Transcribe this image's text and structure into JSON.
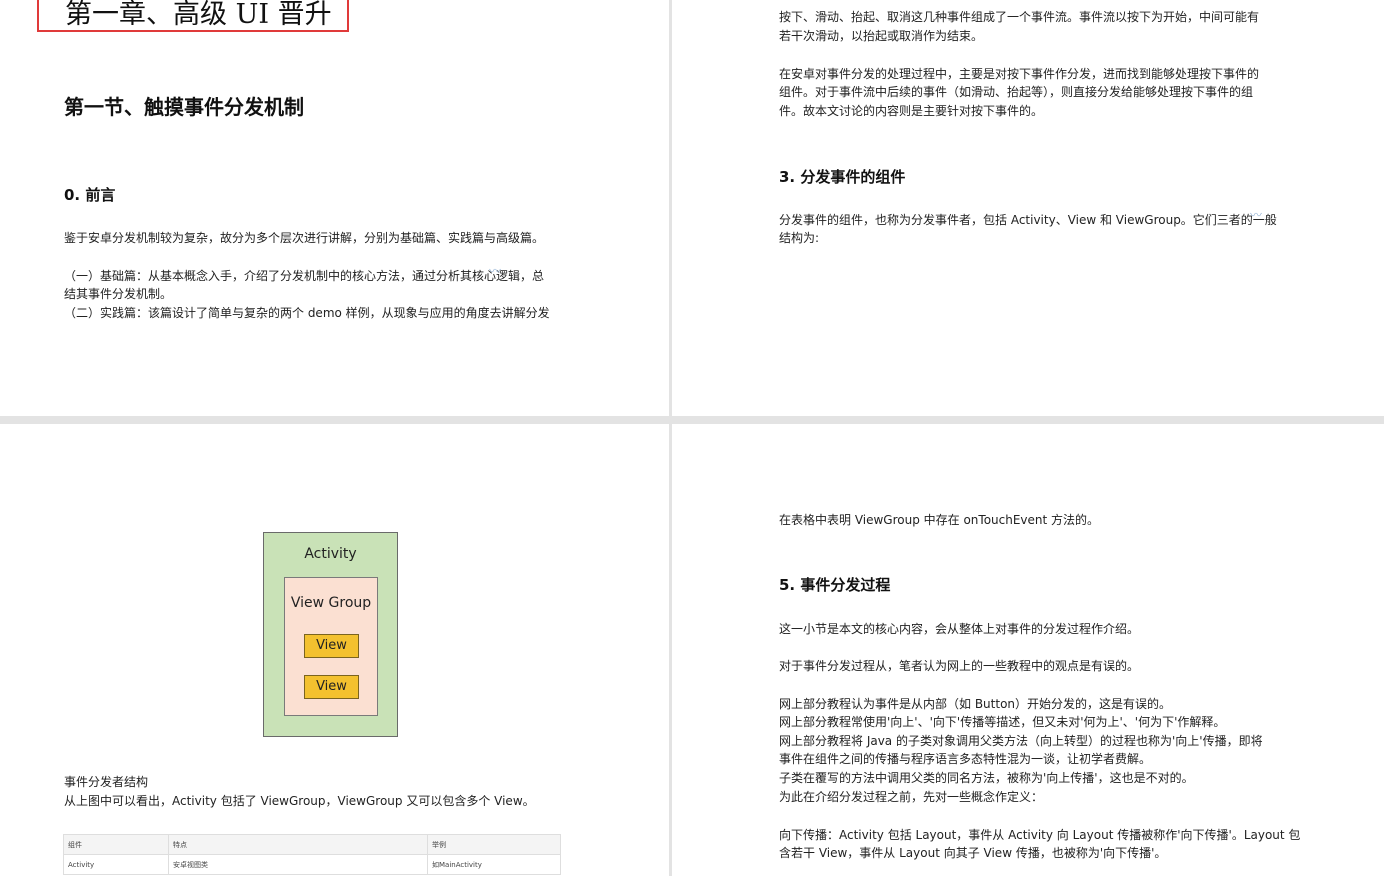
{
  "page1": {
    "chapter_title": "第一章、高级 UI 晋升",
    "section_title": "第一节、触摸事件分发机制",
    "h_preface": "0.  前言",
    "preface_text": "鉴于安卓分发机制较为复杂，故分为多个层次进行讲解，分别为基础篇、实践篇与高级篇。",
    "basic_line1": "（一）基础篇：从基本概念入手，介绍了分发机制中的核心方法，通过分析其核心逻辑，总",
    "basic_line2": "结其事件分发机制。",
    "practice_line": "（二）实践篇：该篇设计了简单与复杂的两个 demo 样例，从现象与应用的角度去讲解分发"
  },
  "page2": {
    "p1_line1": "按下、滑动、抬起、取消这几种事件组成了一个事件流。事件流以按下为开始，中间可能有",
    "p1_line2": "若干次滑动，以抬起或取消作为结束。",
    "p2_line1": "在安卓对事件分发的处理过程中，主要是对按下事件作分发，进而找到能够处理按下事件的",
    "p2_line2": "组件。对于事件流中后续的事件（如滑动、抬起等），则直接分发给能够处理按下事件的组",
    "p2_line3": "件。故本文讨论的内容则是主要针对按下事件的。",
    "h_components": "3.  分发事件的组件",
    "comp_line1": "分发事件的组件，也称为分发事件者，包括 Activity、View 和 ViewGroup。它们三者的一般",
    "comp_line2": "结构为:"
  },
  "page3": {
    "diagram": {
      "outer_label": "Activity",
      "inner_label": "View Group",
      "child1_label": "View",
      "child2_label": "View"
    },
    "caption": "事件分发者结构",
    "caption_text": "从上图中可以看出，Activity 包括了 ViewGroup，ViewGroup 又可以包含多个 View。",
    "table": {
      "headers": [
        "组件",
        "特点",
        "举例"
      ],
      "row1": [
        "Activity",
        "安卓视图类",
        "如MainActivity"
      ]
    }
  },
  "page4": {
    "line_top": "在表格中表明 ViewGroup 中存在 onTouchEvent 方法的。",
    "h_process": "5.  事件分发过程",
    "process_intro": "这一小节是本文的核心内容，会从整体上对事件的分发过程作介绍。",
    "opinion": "对于事件分发过程从，笔者认为网上的一些教程中的观点是有误的。",
    "lines": [
      "网上部分教程认为事件是从内部（如 Button）开始分发的，这是有误的。",
      "网上部分教程常使用'向上'、'向下'传播等描述，但又未对'何为上'、'何为下'作解释。",
      "网上部分教程将 Java 的子类对象调用父类方法（向上转型）的过程也称为'向上'传播，即将",
      "事件在组件之间的传播与程序语言多态特性混为一谈，让初学者费解。",
      "子类在覆写的方法中调用父类的同名方法，被称为'向上传播'，这也是不对的。",
      "为此在介绍分发过程之前，先对一些概念作定义："
    ],
    "down_line1": "向下传播：Activity 包括 Layout，事件从 Activity 向 Layout 传播被称作'向下传播'。Layout 包",
    "down_line2": "含若干 View，事件从 Layout 向其子 View 传播，也被称为'向下传播'。"
  }
}
